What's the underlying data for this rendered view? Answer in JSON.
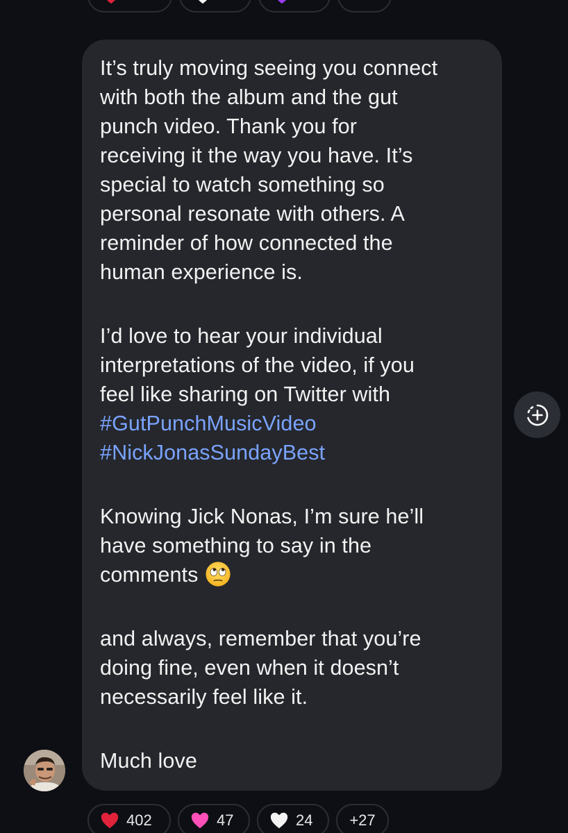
{
  "message": {
    "paragraph1": [
      "It’s truly moving seeing you connect",
      "with both the album and the gut",
      "punch video. Thank you for",
      "receiving it the way you have. It’s",
      "special to watch something so",
      "personal resonate with others. A",
      "reminder of how connected the",
      "human experience is."
    ],
    "paragraph2": [
      "I’d love to hear your individual",
      "interpretations of the video, if you",
      "feel like sharing on Twitter with"
    ],
    "hashtags": [
      "#GutPunchMusicVideo",
      "#NickJonasSundayBest"
    ],
    "paragraph3": [
      "Knowing Jick Nonas, I’m sure he’ll",
      "have something to say in the",
      "comments"
    ],
    "paragraph4": [
      "and always, remember that you’re",
      "doing fine, even when it doesn’t",
      "necessarily feel like it."
    ],
    "signoff": "Much love"
  },
  "reactions_bottom": [
    {
      "icon": "red-heart",
      "count": "402"
    },
    {
      "icon": "pink-heart",
      "count": "47"
    },
    {
      "icon": "white-heart",
      "count": "24"
    },
    {
      "icon": "none",
      "count": "+27"
    }
  ],
  "colors": {
    "background": "#0d0f14",
    "bubble": "#25272c",
    "hashtag": "#7aa3ff",
    "red_heart": "#e0223a",
    "pink_heart": "#ff4fb8",
    "white_heart": "#f4f4f4"
  },
  "icons": {
    "add_reaction": "add-reaction-icon",
    "emoji": "face-with-rolling-eyes"
  }
}
